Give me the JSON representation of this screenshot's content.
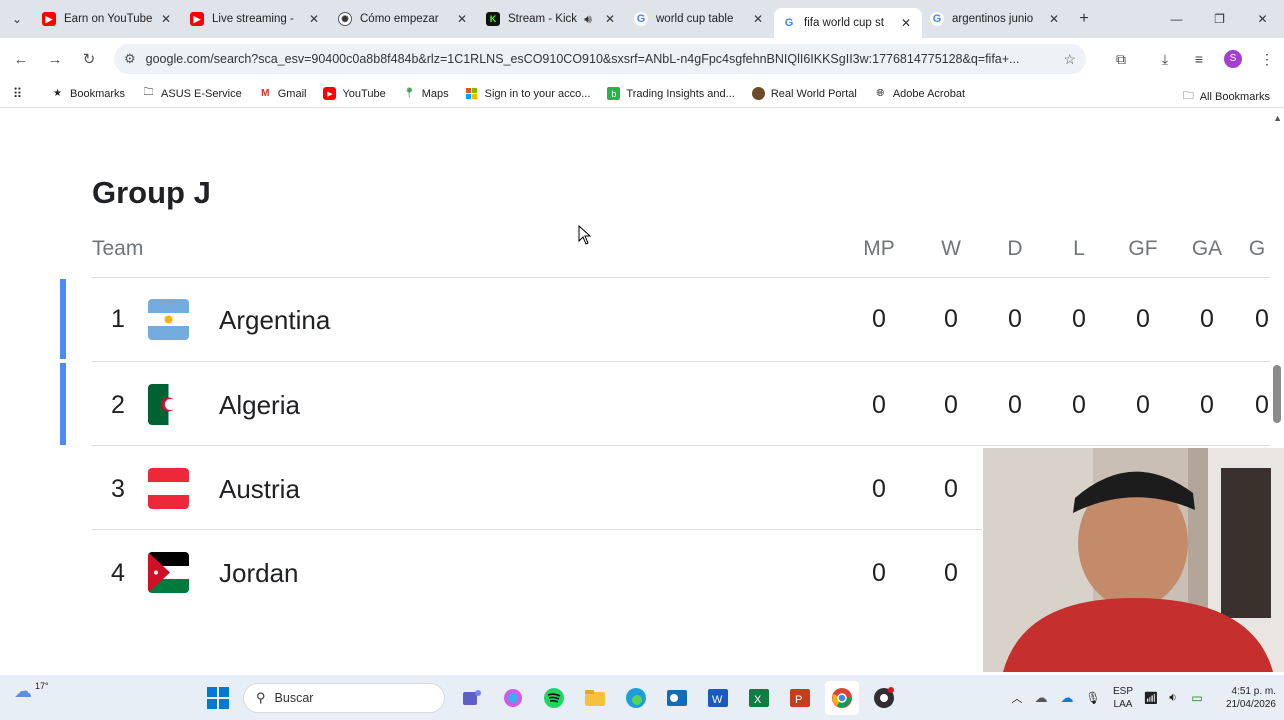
{
  "browser": {
    "tabs": [
      {
        "title": "Earn on YouTube",
        "icon": "youtube-icon",
        "active": false
      },
      {
        "title": "Live streaming -",
        "icon": "youtube-icon",
        "active": false
      },
      {
        "title": "Cómo empezar",
        "icon": "openai-icon",
        "active": false
      },
      {
        "title": "Stream - Kick",
        "icon": "kick-icon",
        "active": false
      },
      {
        "title": "world cup table",
        "icon": "google-icon",
        "active": false
      },
      {
        "title": "fifa world cup st",
        "icon": "google-icon",
        "active": true
      },
      {
        "title": "argentinos junio",
        "icon": "google-icon",
        "active": false
      }
    ],
    "url": "google.com/search?sca_esv=90400c0a8b8f484b&rlz=1C1RLNS_esCO910CO910&sxsrf=ANbL-n4gFpc4sgfehnBNIQlI6IKKSgII3w:1776814775128&q=fifa+...",
    "profile_initial": "S",
    "bookmarks": [
      {
        "label": "Bookmarks",
        "icon": "star-icon"
      },
      {
        "label": "ASUS E-Service",
        "icon": "folder-icon"
      },
      {
        "label": "Gmail",
        "icon": "gmail-icon"
      },
      {
        "label": "YouTube",
        "icon": "youtube-icon"
      },
      {
        "label": "Maps",
        "icon": "maps-icon"
      },
      {
        "label": "Sign in to your acco...",
        "icon": "microsoft-icon"
      },
      {
        "label": "Trading Insights and...",
        "icon": "trading-icon"
      },
      {
        "label": "Real World Portal",
        "icon": "portal-icon"
      },
      {
        "label": "Adobe Acrobat",
        "icon": "globe-icon"
      }
    ],
    "all_bookmarks": "All Bookmarks"
  },
  "standings": {
    "group_title": "Group J",
    "columns": {
      "team": "Team",
      "mp": "MP",
      "w": "W",
      "d": "D",
      "l": "L",
      "gf": "GF",
      "ga": "GA",
      "gd": "G"
    },
    "rows": [
      {
        "rank": "1",
        "team": "Argentina",
        "mp": "0",
        "w": "0",
        "d": "0",
        "l": "0",
        "gf": "0",
        "ga": "0",
        "gd": "0",
        "qualified": true
      },
      {
        "rank": "2",
        "team": "Algeria",
        "mp": "0",
        "w": "0",
        "d": "0",
        "l": "0",
        "gf": "0",
        "ga": "0",
        "gd": "0",
        "qualified": true
      },
      {
        "rank": "3",
        "team": "Austria",
        "mp": "0",
        "w": "0",
        "qualified": false
      },
      {
        "rank": "4",
        "team": "Jordan",
        "mp": "0",
        "w": "0",
        "qualified": false
      }
    ]
  },
  "taskbar": {
    "weather": "17°",
    "search_placeholder": "Buscar",
    "lang_top": "ESP",
    "lang_bottom": "LAA",
    "time": "4:51 p. m.",
    "date": "21/04/2026"
  },
  "colors": {
    "qualified_bar": "#4c8bf5",
    "tabstrip": "#dfe3ea",
    "taskbar": "#e8eef6"
  }
}
